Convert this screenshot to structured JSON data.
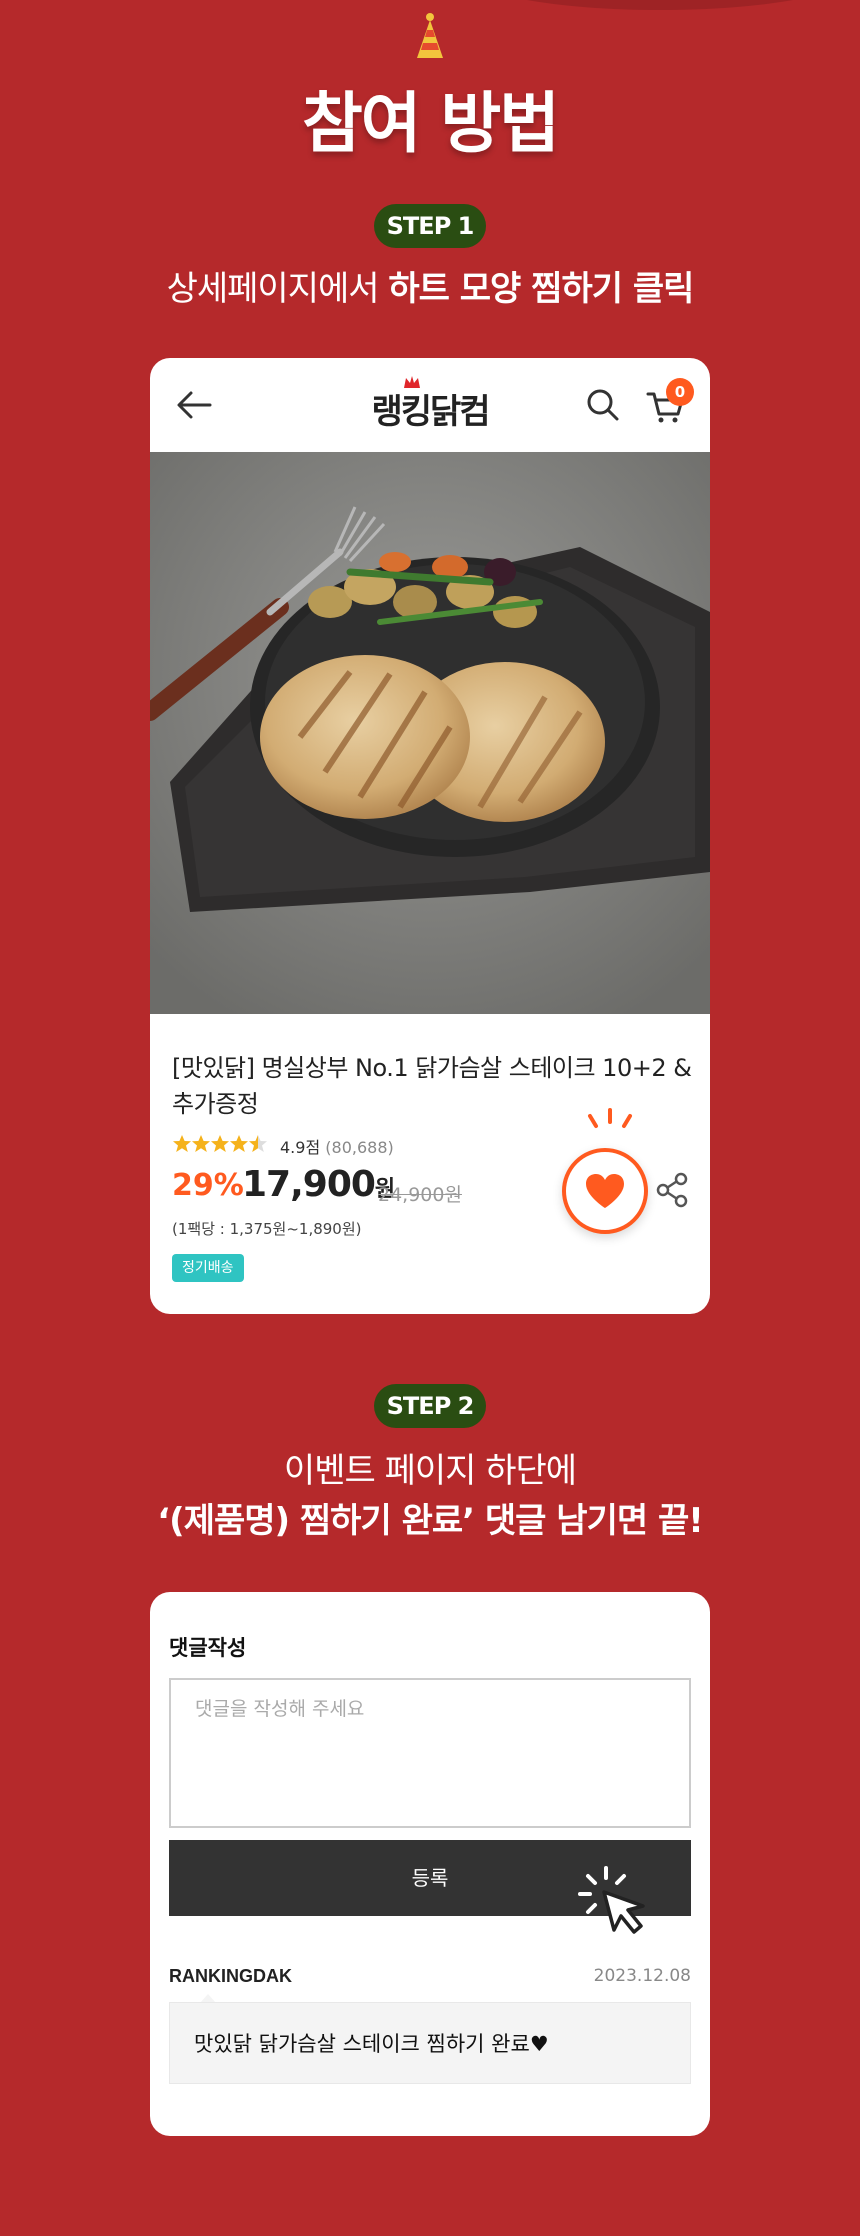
{
  "page": {
    "title": "참여 방법",
    "colors": {
      "background": "#b5292b",
      "step_badge": "#2a4d12",
      "accent": "#ff5a1f"
    }
  },
  "step1": {
    "badge": "STEP 1",
    "heading_plain": "상세페이지에서 ",
    "heading_bold": "하트 모양 찜하기 클릭"
  },
  "app": {
    "logo": "랭킹닭컴",
    "cart_count": "0",
    "icons": [
      "back-arrow-icon",
      "search-icon",
      "cart-icon",
      "heart-icon",
      "share-icon"
    ]
  },
  "product": {
    "name": "[맛있닭] 명실상부 No.1 닭가슴살 스테이크 10+2 & 추가증정",
    "rating": "4.9점",
    "review_count": "(80,688)",
    "stars": 4.5,
    "discount": "29%",
    "price": "17,900",
    "price_unit": "원",
    "original_price": "24,900원",
    "unit_price": "(1팩당 : 1,375원~1,890원)",
    "tag": "정기배송"
  },
  "step2": {
    "badge": "STEP 2",
    "line1": "이벤트 페이지 하단에",
    "line2": "‘(제품명) 찜하기 완료’ 댓글 남기면 끝!"
  },
  "comment_form": {
    "title": "댓글작성",
    "placeholder": "댓글을 작성해 주세요",
    "value": "",
    "submit_label": "등록"
  },
  "comment": {
    "author": "RANKINGDAK",
    "date": "2023.12.08",
    "text": "맛있닭 닭가슴살 스테이크 찜하기 완료♥"
  }
}
